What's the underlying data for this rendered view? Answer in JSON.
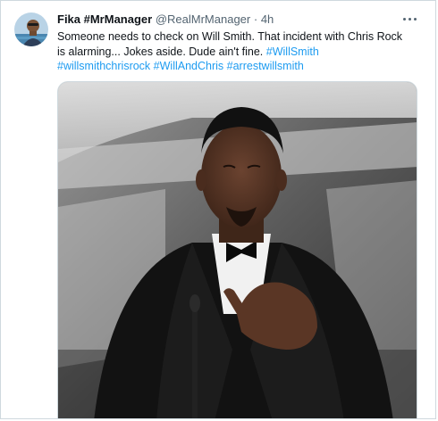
{
  "tweet": {
    "author_name": "Fika #MrManager",
    "handle": "@RealMrManager",
    "separator": "·",
    "time": "4h",
    "text_parts": [
      "Someone needs to check on Will Smith. That incident with Chris Rock is alarming... Jokes aside. Dude ain't fine. "
    ],
    "hashtags": [
      "#WillSmith",
      "#willsmithchrisrock",
      "#WillAndChris",
      "#arrestwillsmith"
    ]
  },
  "icons": {
    "more": "more-horizontal-icon"
  },
  "colors": {
    "text": "#0f1419",
    "secondary": "#536471",
    "link": "#1d9bf0",
    "border": "#cfd9de"
  }
}
